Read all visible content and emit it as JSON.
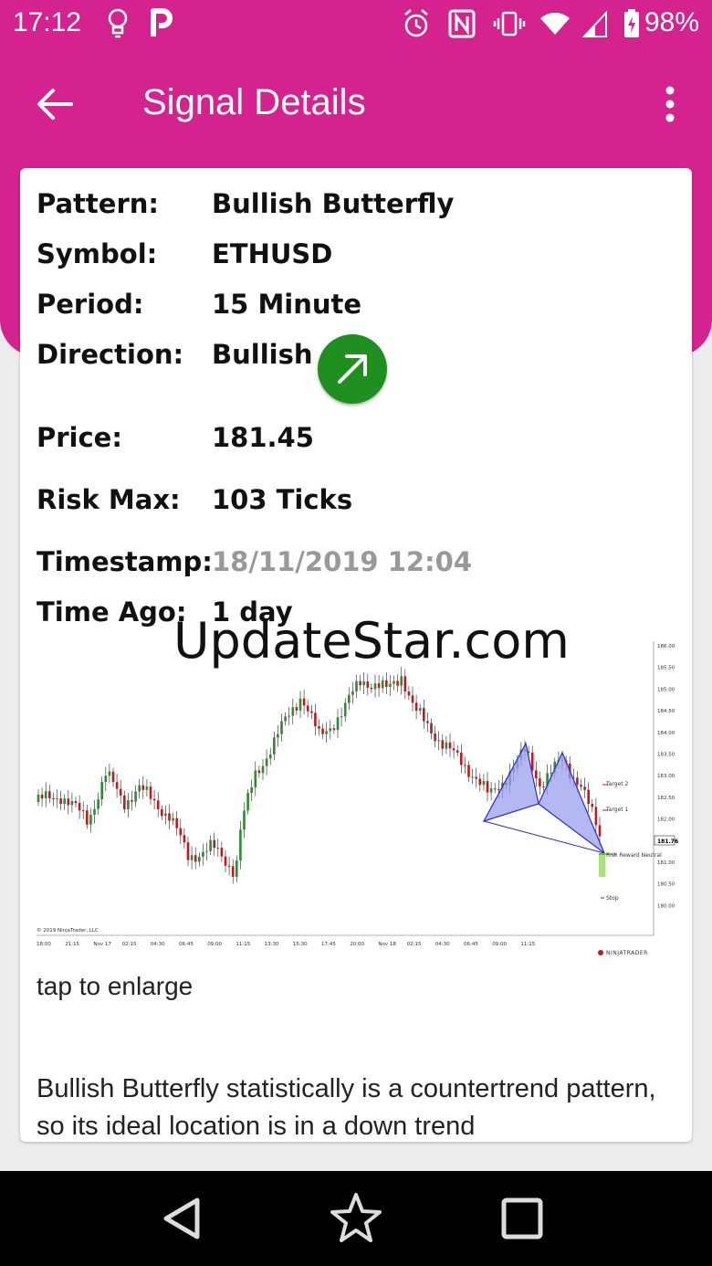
{
  "status_bar": {
    "time": "17:12",
    "battery_text": "98%",
    "left_icons": [
      "lightbulb-icon",
      "p-app-icon"
    ],
    "right_icons": [
      "alarm-icon",
      "nfc-icon",
      "vibrate-icon",
      "wifi-icon",
      "signal-icon",
      "battery-icon"
    ]
  },
  "app_bar": {
    "title": "Signal Details",
    "back_icon": "arrow-left-icon",
    "menu_icon": "more-vert-icon"
  },
  "details": {
    "pattern_label": "Pattern:",
    "pattern_value": "Bullish Butterfly",
    "symbol_label": "Symbol:",
    "symbol_value": "ETHUSD",
    "period_label": "Period:",
    "period_value": "15 Minute",
    "direction_label": "Direction:",
    "direction_value": "Bullish",
    "direction_icon": "arrow-up-right-icon",
    "price_label": "Price:",
    "price_value": "181.45",
    "risk_label": "Risk Max:",
    "risk_value": "103 Ticks",
    "timestamp_label": "Timestamp:",
    "timestamp_value": "18/11/2019 12:04",
    "timeago_label": "Time Ago:",
    "timeago_value": "1 day"
  },
  "watermark": "UpdateStar.com",
  "chart": {
    "y_ticks": [
      "186.00",
      "185.50",
      "185.00",
      "184.50",
      "184.00",
      "183.50",
      "183.00",
      "182.50",
      "182.00",
      "181.50",
      "181.00",
      "180.50",
      "180.00"
    ],
    "x_ticks": [
      "18:00",
      "21:15",
      "Nov 17",
      "02:15",
      "04:30",
      "06:45",
      "09:00",
      "11:15",
      "13:30",
      "15:30",
      "17:45",
      "20:00",
      "Nov 18",
      "02:15",
      "04:30",
      "06:45",
      "09:00",
      "11:15"
    ],
    "price_tag": "181.76",
    "target2_label": "Target 2",
    "target1_label": "Target 1",
    "risk_reward_label": "Risk Reward Neutral",
    "stop_label": "Stop",
    "copyright": "© 2019 NinjaTrader, LLC",
    "brand": "NINJATRADER",
    "colors": {
      "up": "#2e8b2e",
      "down": "#c0181e",
      "pattern_fill": "#9aa0ee",
      "pattern_line": "#2a2ad0",
      "entry_zone": "#a8e07a"
    }
  },
  "tap_text": "tap to enlarge",
  "description": "Bullish Butterfly statistically is a countertrend pattern,  so its ideal location is in a down trend",
  "nav_bar": {
    "back_icon": "triangle-back-icon",
    "home_icon": "star-icon",
    "recents_icon": "square-recents-icon"
  }
}
